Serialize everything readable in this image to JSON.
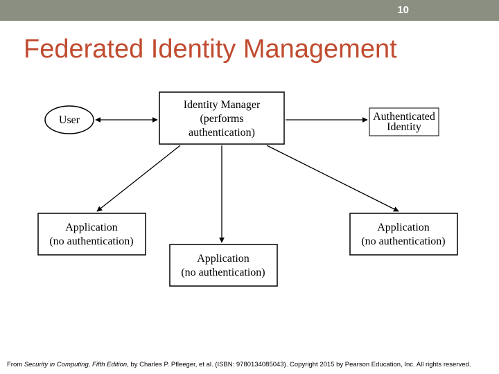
{
  "slide_number": "10",
  "title": "Federated Identity Management",
  "nodes": {
    "user": "User",
    "idmgr_l1": "Identity Manager",
    "idmgr_l2": "(performs",
    "idmgr_l3": "authentication)",
    "authid_l1": "Authenticated",
    "authid_l2": "Identity",
    "app1_l1": "Application",
    "app1_l2": "(no authentication)",
    "app2_l1": "Application",
    "app2_l2": "(no authentication)",
    "app3_l1": "Application",
    "app3_l2": "(no authentication)"
  },
  "footer_prefix": "From ",
  "footer_book": "Security in Computing, Fifth Edition",
  "footer_rest": ", by Charles P. Pfleeger, et al. (ISBN: 9780134085043). Copyright 2015 by Pearson Education, Inc. All rights reserved."
}
